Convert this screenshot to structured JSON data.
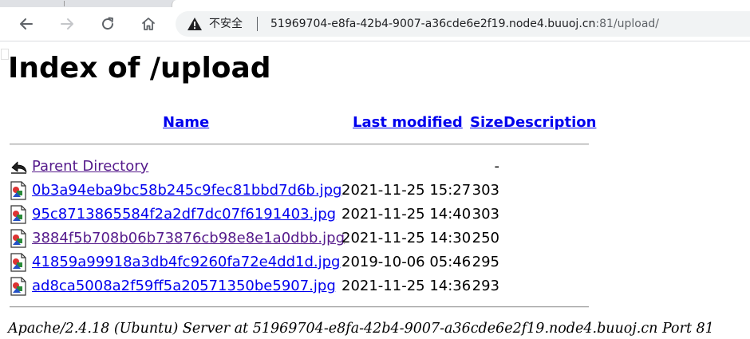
{
  "browser": {
    "security_label": "不安全",
    "url_host": "51969704-e8fa-42b4-9007-a36cde6e2f19.node4.buuoj.cn",
    "url_rest": ":81/upload/"
  },
  "page": {
    "title": "Index of /upload",
    "columns": {
      "name": "Name",
      "last_modified": "Last modified",
      "size": "Size",
      "description": "Description"
    },
    "parent": {
      "name": "Parent Directory",
      "size": "-"
    },
    "files": [
      {
        "name": "0b3a94eba9bc58b245c9fec81bbd7d6b.jpg",
        "modified": "2021-11-25 15:27",
        "size": "303",
        "visited": false
      },
      {
        "name": "95c8713865584f2a2df7dc07f6191403.jpg",
        "modified": "2021-11-25 14:40",
        "size": "303",
        "visited": false
      },
      {
        "name": "3884f5b708b06b73876cb98e8e1a0dbb.jpg",
        "modified": "2021-11-25 14:30",
        "size": "250",
        "visited": true
      },
      {
        "name": "41859a99918a3db4fc9260fa72e4dd1d.jpg",
        "modified": "2019-10-06 05:46",
        "size": "295",
        "visited": false
      },
      {
        "name": "ad8ca5008a2f59ff5a20571350be5907.jpg",
        "modified": "2021-11-25 14:36",
        "size": "293",
        "visited": false
      }
    ],
    "footer": "Apache/2.4.18 (Ubuntu) Server at 51969704-e8fa-42b4-9007-a36cde6e2f19.node4.buuoj.cn Port 81"
  },
  "icons": {
    "back": "back-arrow-icon",
    "forward": "forward-arrow-icon",
    "reload": "reload-icon",
    "home": "home-icon",
    "security": "warning-triangle-icon",
    "parent": "back-folder-icon",
    "file": "image-file-icon"
  },
  "colors": {
    "link": "#0000ee",
    "visited_link": "#551a8b",
    "omnibox_bg": "#f1f3f4"
  }
}
